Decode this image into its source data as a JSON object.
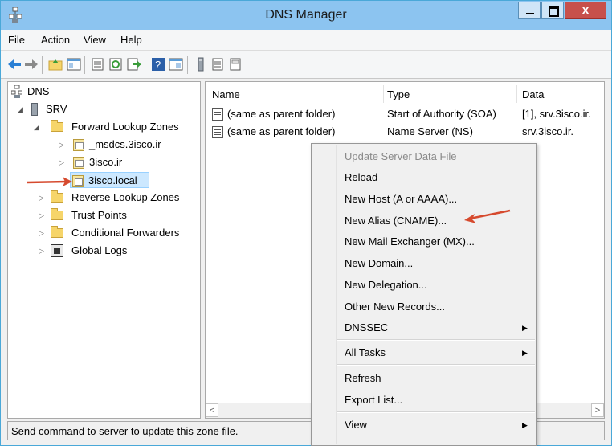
{
  "window": {
    "title": "DNS Manager",
    "close_glyph": "x"
  },
  "menu": [
    "File",
    "Action",
    "View",
    "Help"
  ],
  "toolbar": {
    "icons": [
      "back-icon",
      "forward-icon",
      "up-folder-icon",
      "show-hide-tree-icon",
      "properties-icon",
      "refresh-icon",
      "export-list-icon",
      "help-icon",
      "console-icon",
      "server-icon",
      "list-icon",
      "properties-sheet-icon"
    ]
  },
  "tree": {
    "root": "DNS",
    "server": "SRV",
    "forward_zones": "Forward Lookup Zones",
    "zones": [
      "_msdcs.3isco.ir",
      "3isco.ir",
      "3isco.local"
    ],
    "reverse_zones": "Reverse Lookup Zones",
    "trust_points": "Trust Points",
    "conditional_forwarders": "Conditional Forwarders",
    "global_logs": "Global Logs"
  },
  "list": {
    "columns": [
      "Name",
      "Type",
      "Data"
    ],
    "rows": [
      {
        "name": "(same as parent folder)",
        "type": "Start of Authority (SOA)",
        "data": "[1], srv.3isco.ir."
      },
      {
        "name": "(same as parent folder)",
        "type": "Name Server (NS)",
        "data": "srv.3isco.ir."
      }
    ]
  },
  "context_menu": {
    "update_server_data_file": "Update Server Data File",
    "reload": "Reload",
    "new_host": "New Host (A or AAAA)...",
    "new_alias": "New Alias (CNAME)...",
    "new_mail_exchanger": "New Mail Exchanger (MX)...",
    "new_domain": "New Domain...",
    "new_delegation": "New Delegation...",
    "other_new_records": "Other New Records...",
    "dnssec": "DNSSEC",
    "all_tasks": "All Tasks",
    "refresh": "Refresh",
    "export_list": "Export List...",
    "view": "View"
  },
  "status": "Send command to server to update this zone file.",
  "colors": {
    "annotation_arrow": "#d64a2e",
    "selection": "#cce8ff",
    "titlebar": "#8cc4f0"
  }
}
